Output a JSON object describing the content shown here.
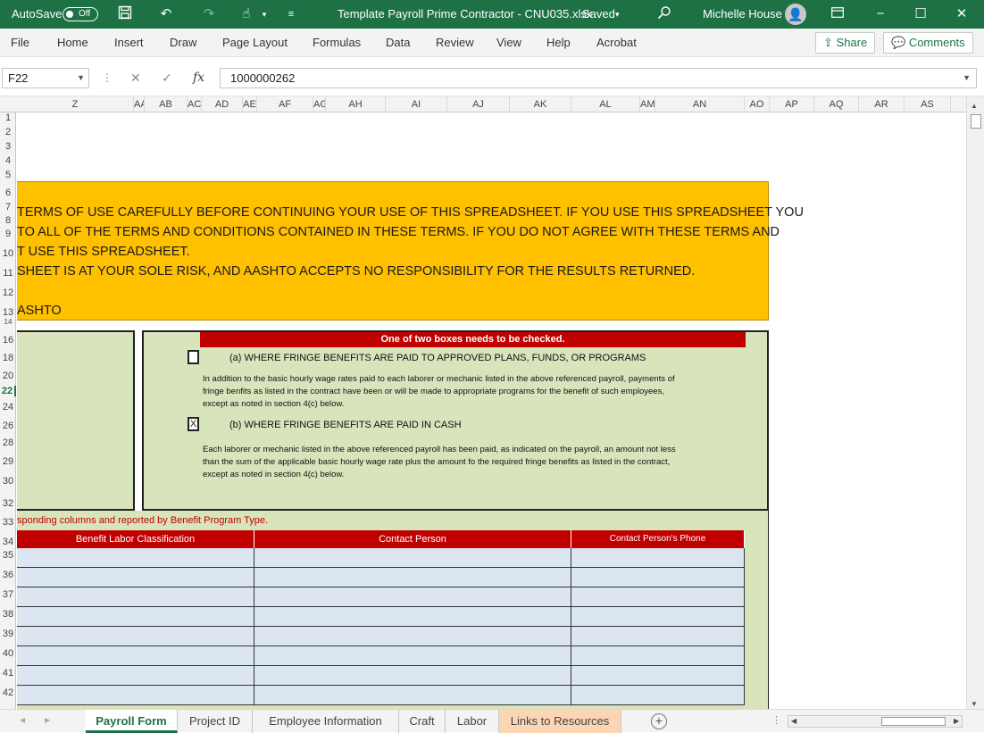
{
  "titlebar": {
    "autosave_label": "AutoSave",
    "autosave_state": "Off",
    "document_title": "Template Payroll Prime Contractor - CNU035.xlsx",
    "save_status": "Saved",
    "user_name": "Michelle House",
    "icons": [
      "save-icon",
      "undo-icon",
      "redo-icon",
      "touch-mode-icon",
      "customize-qat-icon",
      "search-icon",
      "ribbon-display-icon",
      "minimize-icon",
      "maximize-icon",
      "close-icon"
    ],
    "accent": "#1e7145"
  },
  "menu": {
    "items": [
      "File",
      "Home",
      "Insert",
      "Draw",
      "Page Layout",
      "Formulas",
      "Data",
      "Review",
      "View",
      "Help",
      "Acrobat"
    ],
    "share_label": "Share",
    "comments_label": "Comments"
  },
  "formula_bar": {
    "name_box": "F22",
    "fx_label": "fx",
    "formula_value": "1000000262"
  },
  "columns": [
    "Z",
    "AA",
    "AB",
    "AC",
    "AD",
    "AE",
    "AF",
    "AG",
    "AH",
    "AI",
    "AJ",
    "AK",
    "AL",
    "AM",
    "AN",
    "AO",
    "AP",
    "AQ",
    "AR",
    "AS"
  ],
  "rows": [
    "1",
    "2",
    "3",
    "4",
    "5",
    "6",
    "7",
    "8",
    "9",
    "10",
    "11",
    "12",
    "13",
    "14",
    "16",
    "18",
    "20",
    "22",
    "24",
    "26",
    "28",
    "29",
    "30",
    "32",
    "33",
    "34",
    "35",
    "36",
    "37",
    "38",
    "39",
    "40",
    "41",
    "42"
  ],
  "active_row": "22",
  "terms": {
    "line1": "TERMS OF USE CAREFULLY BEFORE CONTINUING YOUR USE OF THIS SPREADSHEET. IF YOU USE THIS SPREADSHEET YOU",
    "line2": "TO ALL OF THE TERMS AND CONDITIONS CONTAINED IN THESE TERMS. IF YOU DO NOT AGREE WITH THESE TERMS AND",
    "line3": "T USE THIS SPREADSHEET.",
    "line4": "SHEET IS AT YOUR SOLE RISK, AND AASHTO ACCEPTS NO RESPONSIBILITY FOR THE RESULTS RETURNED.",
    "line5": "ASHTO",
    "fill_color": "#ffc000"
  },
  "fringe": {
    "header": "One of two boxes needs to be checked.",
    "option_a": "(a) WHERE FRINGE BENEFITS ARE PAID TO APPROVED PLANS, FUNDS, OR PROGRAMS",
    "option_a_checked": "",
    "para_a_1": "In addition to the basic hourly wage rates paid to each laborer or mechanic listed in the above referenced payroll, payments of",
    "para_a_2": "fringe benfits as listed in the contract have been or will be made to appropriate programs for the benefit of such employees,",
    "para_a_3": "except as noted in section 4(c) below.",
    "option_b": "(b) WHERE FRINGE BENEFITS ARE PAID IN CASH",
    "option_b_checked": "X",
    "para_b_1": "Each laborer or mechanic listed in the above referenced payroll has been paid, as indicated on the payroll, an amount not less",
    "para_b_2": "than the sum of the applicable basic hourly wage rate plus the amount fo the required fringe benefits as listed in the contract,",
    "para_b_3": "except as noted in section 4(c) below.",
    "panel_color": "#d8e4bc",
    "header_color": "#c00000"
  },
  "benefits": {
    "note": "sponding columns and reported by Benefit Program Type.",
    "col1": "Benefit Labor Classification",
    "col2": "Contact Person",
    "col3": "Contact Person's Phone",
    "empty_rows": 8,
    "row_color": "#dce6f1"
  },
  "sheets": {
    "tabs": [
      "Payroll Form",
      "Project ID",
      "Employee Information",
      "Craft",
      "Labor",
      "Links to Resources"
    ],
    "active": "Payroll Form"
  }
}
